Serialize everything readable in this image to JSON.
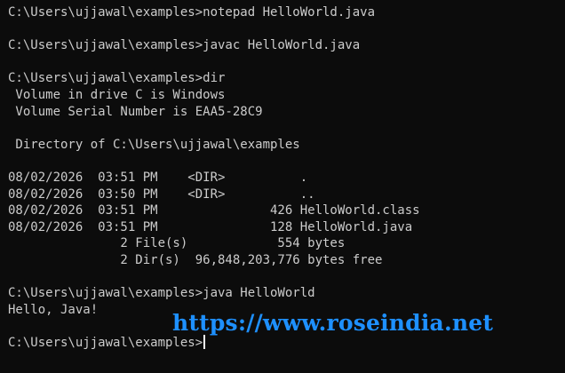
{
  "window": {
    "background": "#0c0c0c",
    "text_color": "#cccccc"
  },
  "terminal": {
    "lines": [
      "C:\\Users\\ujjawal\\examples>notepad HelloWorld.java",
      "",
      "C:\\Users\\ujjawal\\examples>javac HelloWorld.java",
      "",
      "C:\\Users\\ujjawal\\examples>dir",
      " Volume in drive C is Windows",
      " Volume Serial Number is EAA5-28C9",
      "",
      " Directory of C:\\Users\\ujjawal\\examples",
      "",
      "08/02/2026  03:51 PM    <DIR>          .",
      "08/02/2026  03:50 PM    <DIR>          ..",
      "08/02/2026  03:51 PM               426 HelloWorld.class",
      "08/02/2026  03:51 PM               128 HelloWorld.java",
      "               2 File(s)            554 bytes",
      "               2 Dir(s)  96,848,203,776 bytes free",
      "",
      "C:\\Users\\ujjawal\\examples>java HelloWorld",
      "Hello, Java!",
      "",
      "C:\\Users\\ujjawal\\examples>"
    ]
  },
  "watermark": {
    "text": "https://www.roseindia.net",
    "color": "#1e90ff"
  },
  "cursor_icon": "text-cursor-icon"
}
